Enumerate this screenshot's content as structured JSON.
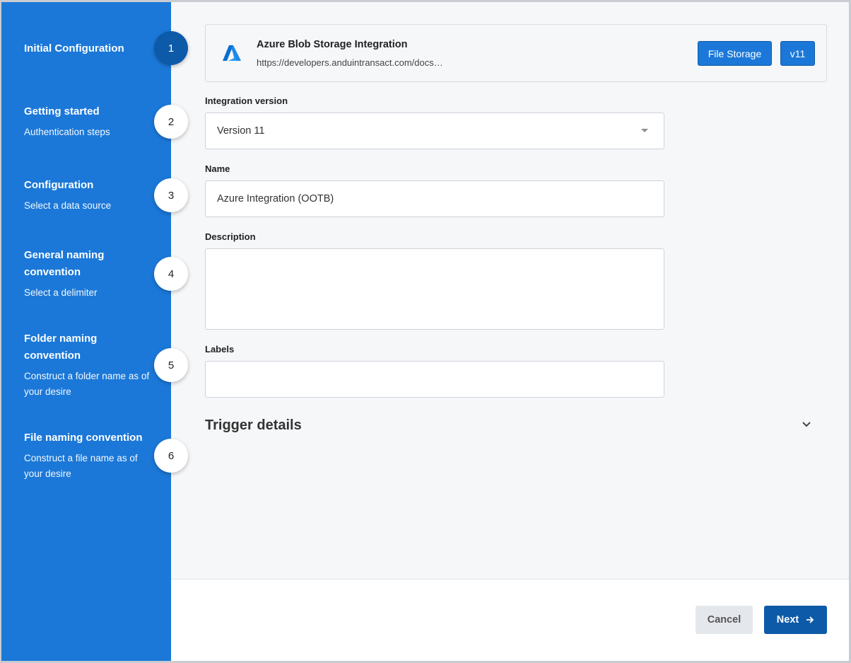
{
  "sidebar": {
    "steps": [
      {
        "number": "1",
        "title": "Initial Configuration",
        "subtitle": ""
      },
      {
        "number": "2",
        "title": "Getting started",
        "subtitle": "Authentication steps"
      },
      {
        "number": "3",
        "title": "Configuration",
        "subtitle": "Select a data source"
      },
      {
        "number": "4",
        "title": "General naming convention",
        "subtitle": "Select a delimiter"
      },
      {
        "number": "5",
        "title": "Folder naming convention",
        "subtitle": "Construct a folder name as of your desire"
      },
      {
        "number": "6",
        "title": "File naming convention",
        "subtitle": "Construct a file name as of your desire"
      }
    ],
    "active_step": 1
  },
  "integration": {
    "title": "Azure Blob Storage Integration",
    "url": "https://developers.anduintransact.com/docs…",
    "tag_type": "File Storage",
    "tag_version": "v11",
    "logo_icon": "azure-logo-icon"
  },
  "form": {
    "version_label": "Integration version",
    "version_value": "Version 11",
    "name_label": "Name",
    "name_value": "Azure Integration (OOTB)",
    "description_label": "Description",
    "description_value": "",
    "labels_label": "Labels",
    "labels_value": ""
  },
  "trigger": {
    "title": "Trigger details"
  },
  "footer": {
    "cancel_label": "Cancel",
    "next_label": "Next"
  },
  "colors": {
    "sidebar": "#1b78d8",
    "active_step": "#0d5aa8",
    "primary_button": "#0d5aa8"
  }
}
